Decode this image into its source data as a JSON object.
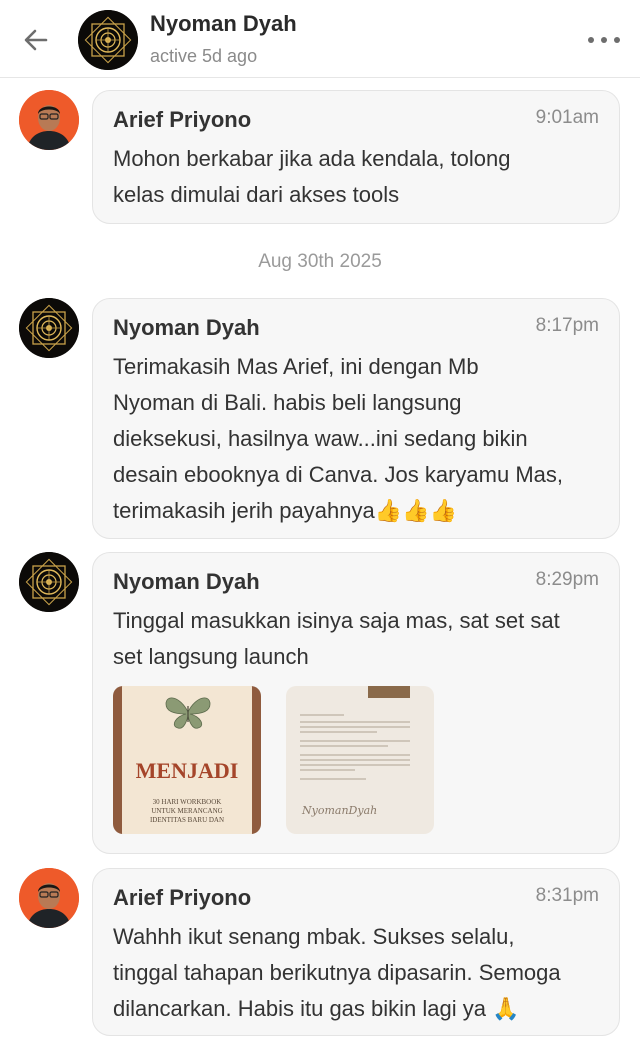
{
  "header": {
    "name": "Nyoman Dyah",
    "status": "active 5d ago"
  },
  "date_separator": "Aug 30th 2025",
  "messages": [
    {
      "sender": "Arief Priyono",
      "time": "9:01am",
      "lines": [
        "Mohon berkabar jika ada kendala, tolong",
        "kelas dimulai dari akses tools"
      ]
    },
    {
      "sender": "Nyoman Dyah",
      "time": "8:17pm",
      "lines": [
        "Terimakasih Mas Arief, ini dengan Mb",
        "Nyoman di Bali. habis beli langsung",
        "dieksekusi, hasilnya waw...ini sedang bikin",
        "desain ebooknya di Canva. Jos karyamu Mas,",
        "terimakasih jerih payahnya👍👍👍"
      ]
    },
    {
      "sender": "Nyoman Dyah",
      "time": "8:29pm",
      "lines": [
        "Tinggal masukkan isinya saja mas, sat set sat",
        "set langsung launch"
      ],
      "attachments": [
        {
          "title": "MENJADI",
          "subtitle_lines": [
            "30 HARI WORKBOOK",
            "UNTUK MERANCANG",
            "IDENTITAS BARU DAN"
          ]
        },
        {
          "signature": "NyomanDyah"
        }
      ]
    },
    {
      "sender": "Arief Priyono",
      "time": "8:31pm",
      "lines": [
        "Wahhh ikut senang mbak. Sukses selalu,",
        "tinggal tahapan berikutnya dipasarin. Semoga",
        "dilancarkan. Habis itu gas bikin lagi ya 🙏"
      ]
    }
  ],
  "icons": {
    "back": "arrow-left-icon",
    "more": "more-horizontal-icon"
  }
}
